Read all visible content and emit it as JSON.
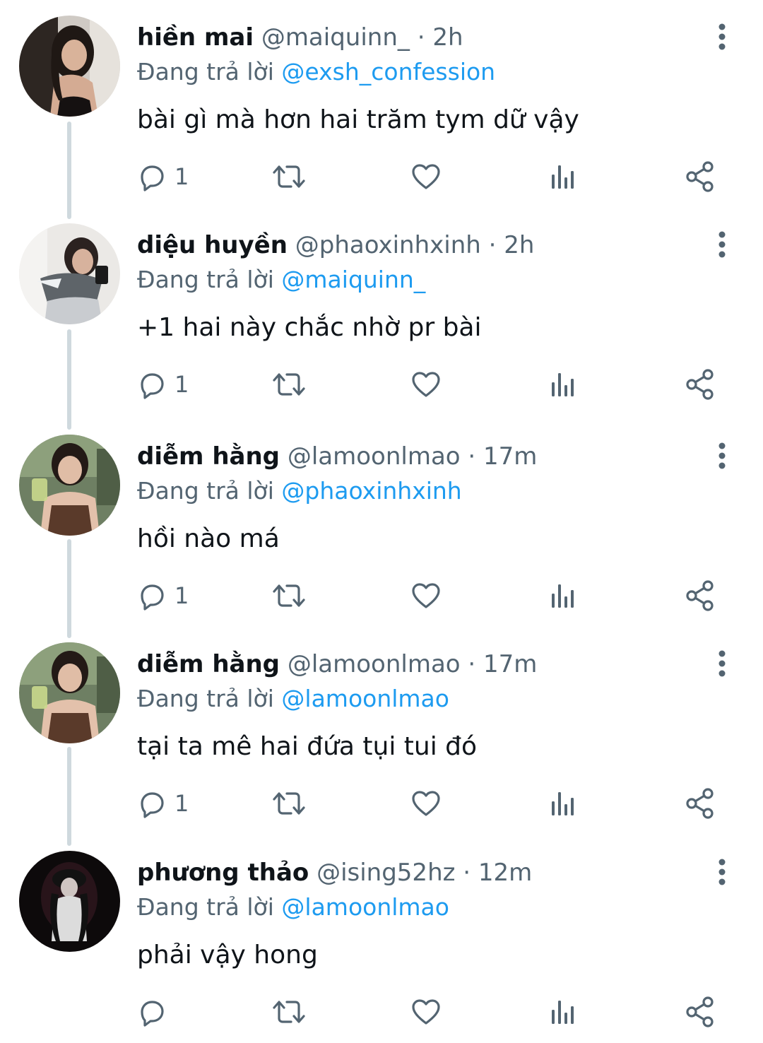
{
  "replying_prefix": "Đang trả lời",
  "tweets": [
    {
      "name": "hiền mai",
      "handle": "@maiquinn_",
      "time": "2h",
      "replying_to": "@exsh_confession",
      "text": "bài gì mà hơn hai trăm tym dữ vậy",
      "reply_count": "1"
    },
    {
      "name": "diệu huyền",
      "handle": "@phaoxinhxinh",
      "time": "2h",
      "replying_to": "@maiquinn_",
      "text": "+1 hai này chắc nhờ pr bài",
      "reply_count": "1"
    },
    {
      "name": "diễm hằng",
      "handle": "@lamoonlmao",
      "time": "17m",
      "replying_to": "@phaoxinhxinh",
      "text": "hồi nào má",
      "reply_count": "1"
    },
    {
      "name": "diễm hằng",
      "handle": "@lamoonlmao",
      "time": "17m",
      "replying_to": "@lamoonlmao",
      "text": "tại ta mê hai đứa tụi tui đó",
      "reply_count": "1"
    },
    {
      "name": "phương thảo",
      "handle": "@ising52hz",
      "time": "12m",
      "replying_to": "@lamoonlmao",
      "text": "phải vậy hong",
      "reply_count": ""
    }
  ],
  "colors": {
    "text_primary": "#0f1419",
    "text_secondary": "#536471",
    "mention_blue": "#1d9bf0",
    "thread_line": "#cfd9de",
    "icon_gray": "#536471"
  },
  "icons": {
    "reply": "speech-bubble-icon",
    "retweet": "retweet-arrows-icon",
    "like": "heart-outline-icon",
    "views": "bar-chart-icon",
    "share": "share-nodes-icon",
    "more": "vertical-dots-icon"
  }
}
